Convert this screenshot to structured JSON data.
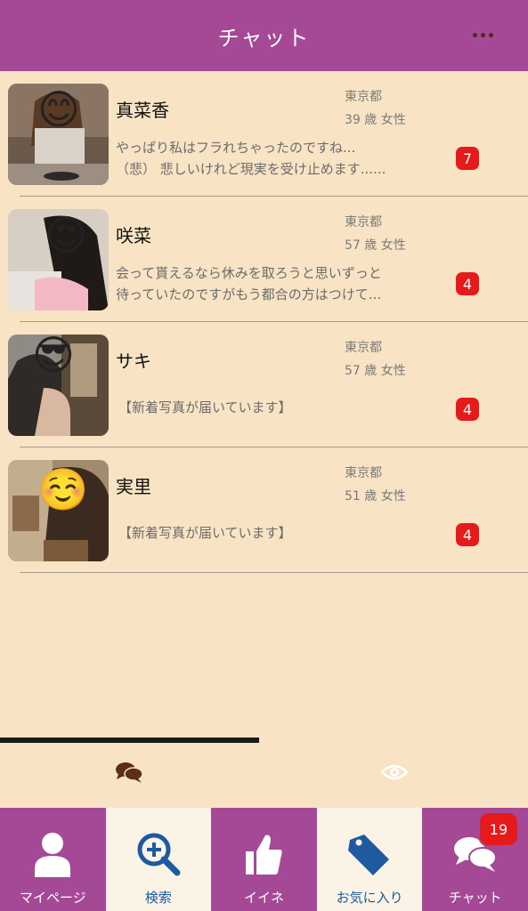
{
  "header": {
    "title": "チャット"
  },
  "chats": [
    {
      "name": "真菜香",
      "location": "東京都",
      "age_gender": "39 歳 女性",
      "message_lines": [
        "やっぱり私はフラれちゃったのですね...",
        "（悲） 悲しいけれど現実を受け止めます......"
      ],
      "unread": "7",
      "emoji": "😊"
    },
    {
      "name": "咲菜",
      "location": "東京都",
      "age_gender": "57 歳 女性",
      "message_lines": [
        "会って貰えるなら休みを取ろうと思いずっと",
        "待っていたのですがもう都合の方はつけて..."
      ],
      "unread": "4",
      "emoji": "😍"
    },
    {
      "name": "サキ",
      "location": "東京都",
      "age_gender": "57 歳 女性",
      "message_lines": [
        "【新着写真が届いています】"
      ],
      "unread": "4",
      "emoji": "😎"
    },
    {
      "name": "実里",
      "location": "東京都",
      "age_gender": "51 歳 女性",
      "message_lines": [
        "【新着写真が届いています】"
      ],
      "unread": "4",
      "emoji": "☺️"
    }
  ],
  "subtabs": {
    "active": "chat"
  },
  "bottom_nav": [
    {
      "label": "マイページ",
      "icon": "person-icon"
    },
    {
      "label": "検索",
      "icon": "search-icon"
    },
    {
      "label": "イイネ",
      "icon": "thumbs-up-icon"
    },
    {
      "label": "お気に入り",
      "icon": "tag-icon"
    },
    {
      "label": "チャット",
      "icon": "chat-icon",
      "badge": "19"
    }
  ],
  "colors": {
    "accent": "#a54896",
    "background": "#f8e4c5",
    "badge": "#e61a1a"
  }
}
